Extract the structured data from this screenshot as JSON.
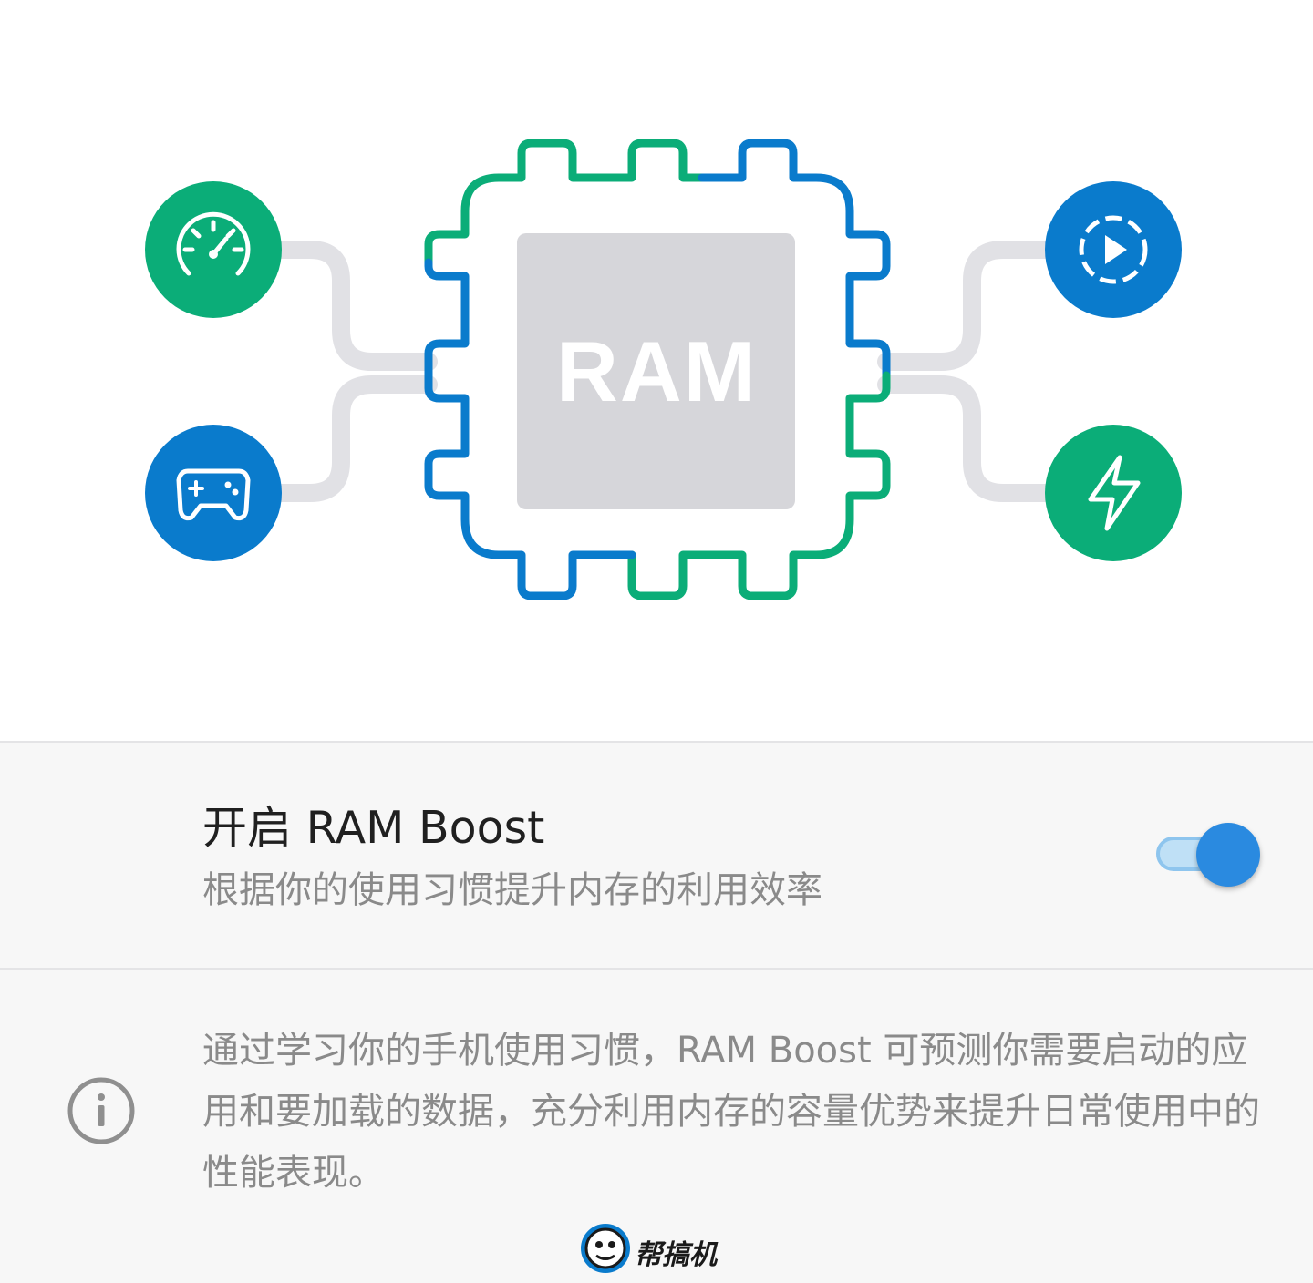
{
  "hero": {
    "chip_label": "RAM",
    "icons": [
      "speedometer-icon",
      "gamepad-icon",
      "play-circle-icon",
      "lightning-icon"
    ],
    "colors": {
      "green": "#0bad78",
      "blue": "#0a7bcc",
      "chip_fill": "#d6d6da",
      "connector": "#e1e1e5"
    }
  },
  "toggle": {
    "title": "开启 RAM Boost",
    "subtitle": "根据你的使用习惯提升内存的利用效率",
    "enabled": true,
    "accent_color": "#2a8ae0"
  },
  "info": {
    "icon": "info-icon",
    "text": "通过学习你的手机使用习惯，RAM Boost 可预测你需要启动的应用和要加载的数据，充分利用内存的容量优势来提升日常使用中的性能表现。"
  },
  "watermark": {
    "text": "帮搞机"
  }
}
